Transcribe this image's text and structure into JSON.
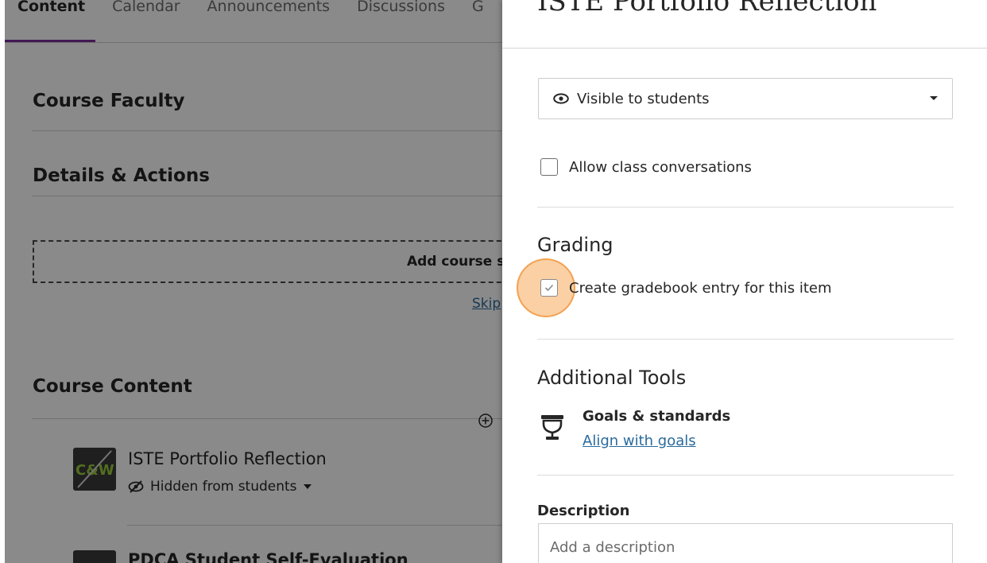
{
  "course": {
    "tabs": [
      {
        "label": "Content"
      },
      {
        "label": "Calendar"
      },
      {
        "label": "Announcements"
      },
      {
        "label": "Discussions"
      },
      {
        "label": "G"
      }
    ],
    "sections": {
      "faculty": "Course Faculty",
      "details": "Details & Actions",
      "content": "Course Content"
    },
    "add_course_text": "Add course s",
    "skip_link": "Skip",
    "items": [
      {
        "title": "ISTE Portfolio Reflection",
        "thumb_text": "C&W",
        "visibility": "Hidden from students"
      },
      {
        "title": "PDCA Student Self-Evaluation"
      }
    ]
  },
  "panel": {
    "title": "ISTE Portfolio Reflection",
    "visibility_value": "Visible to students",
    "allow_conversations_label": "Allow class conversations",
    "grading_heading": "Grading",
    "gradebook_label": "Create gradebook entry for this item",
    "gradebook_checked": true,
    "additional_tools_heading": "Additional Tools",
    "goals_title": "Goals & standards",
    "goals_link": "Align with goals",
    "description_label": "Description",
    "description_placeholder": "Add a description"
  },
  "colors": {
    "accent": "#7a2d9a",
    "link": "#2a6a9c",
    "click_highlight": "#f5aa5a"
  }
}
